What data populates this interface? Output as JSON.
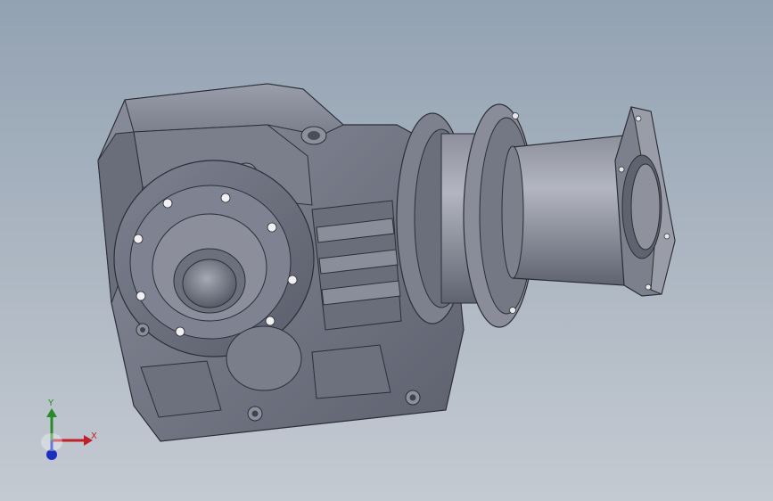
{
  "viewport": {
    "background_top": "#93a2b2",
    "background_bottom": "#c4cad2",
    "model_color": "#6e727f"
  },
  "model": {
    "name_icon": "gear-reducer-model"
  },
  "triad": {
    "x_label": "X",
    "y_label": "Y",
    "x_color": "#c0202a",
    "y_color": "#2a8a2a",
    "z_color": "#1a2fc0"
  }
}
